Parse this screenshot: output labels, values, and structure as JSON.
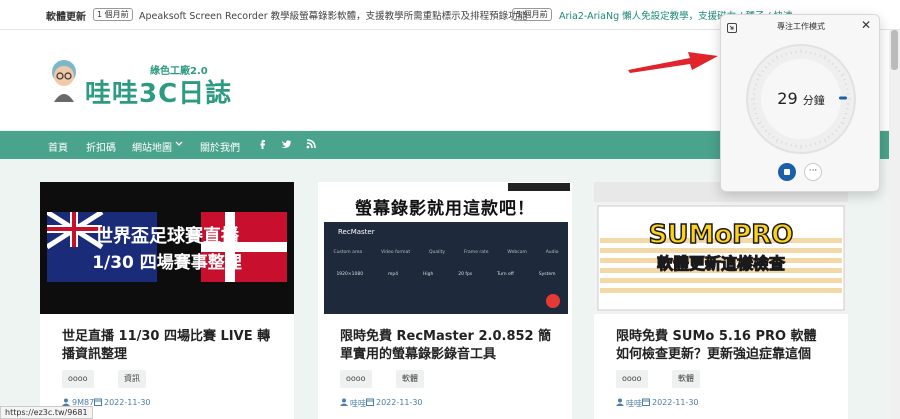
{
  "topbar": {
    "label": "軟體更新",
    "item1": {
      "badge": "1 個月前",
      "text": "Apeaksoft Screen Recorder 教學級螢幕錄影軟體，支援教學所需重點標示及排程預錄功能"
    },
    "item2": {
      "badge": "5 個月前",
      "text": "Aria2-AriaNg 懶人免設定教學，支援磁力 / 種子 / 快速"
    }
  },
  "logo": {
    "sub": "綠色工廠2.0",
    "main": "哇哇3C日誌"
  },
  "nav": {
    "items": [
      "首頁",
      "折扣碼",
      "網站地圖",
      "關於我們"
    ],
    "dropdown_icon": "chevron-down-icon"
  },
  "cards": [
    {
      "thumb": {
        "line1": "世界盃足球賽直播",
        "line2": "1/30 四場賽事整理"
      },
      "title": "世足直播 11/30 四場比賽 LIVE 轉播資訊整理",
      "tags": [
        "oooo",
        "資訊"
      ],
      "author": "9M87",
      "date": "2022-11-30"
    },
    {
      "thumb": {
        "line1": "螢幕錄影就用這款吧！",
        "app": "RecMaster",
        "win": "",
        "labels": [
          "Custom area",
          "Video format",
          "Quality",
          "Frame rate",
          "Webcam",
          "Audio"
        ],
        "values": [
          "1920×1080",
          "mp4",
          "High",
          "20 fps",
          "Turn off",
          "System"
        ]
      },
      "title": "限時免費 RecMaster 2.0.852 簡單實用的螢幕錄影錄音工具",
      "tags": [
        "oooo",
        "軟體"
      ],
      "author": "哇哇",
      "date": "2022-11-30"
    },
    {
      "thumb": {
        "line1": "SUMoPRO",
        "line2": "軟體更新這樣檢查"
      },
      "title": "限時免費 SUMo 5.16 PRO 軟體如何檢查更新？更新強迫症靠這個",
      "tags": [
        "oooo",
        "軟體"
      ],
      "author": "哇哇",
      "date": "2022-11-30"
    }
  ],
  "status": {
    "url": "https://ez3c.tw/9681"
  },
  "focus": {
    "title": "專注工作模式",
    "minutes": "29",
    "unit": "分鐘"
  },
  "colors": {
    "brand": "#4aa38c",
    "accent": "#2d9b83",
    "arrow": "#e0242a",
    "stop": "#1a5fa8"
  }
}
